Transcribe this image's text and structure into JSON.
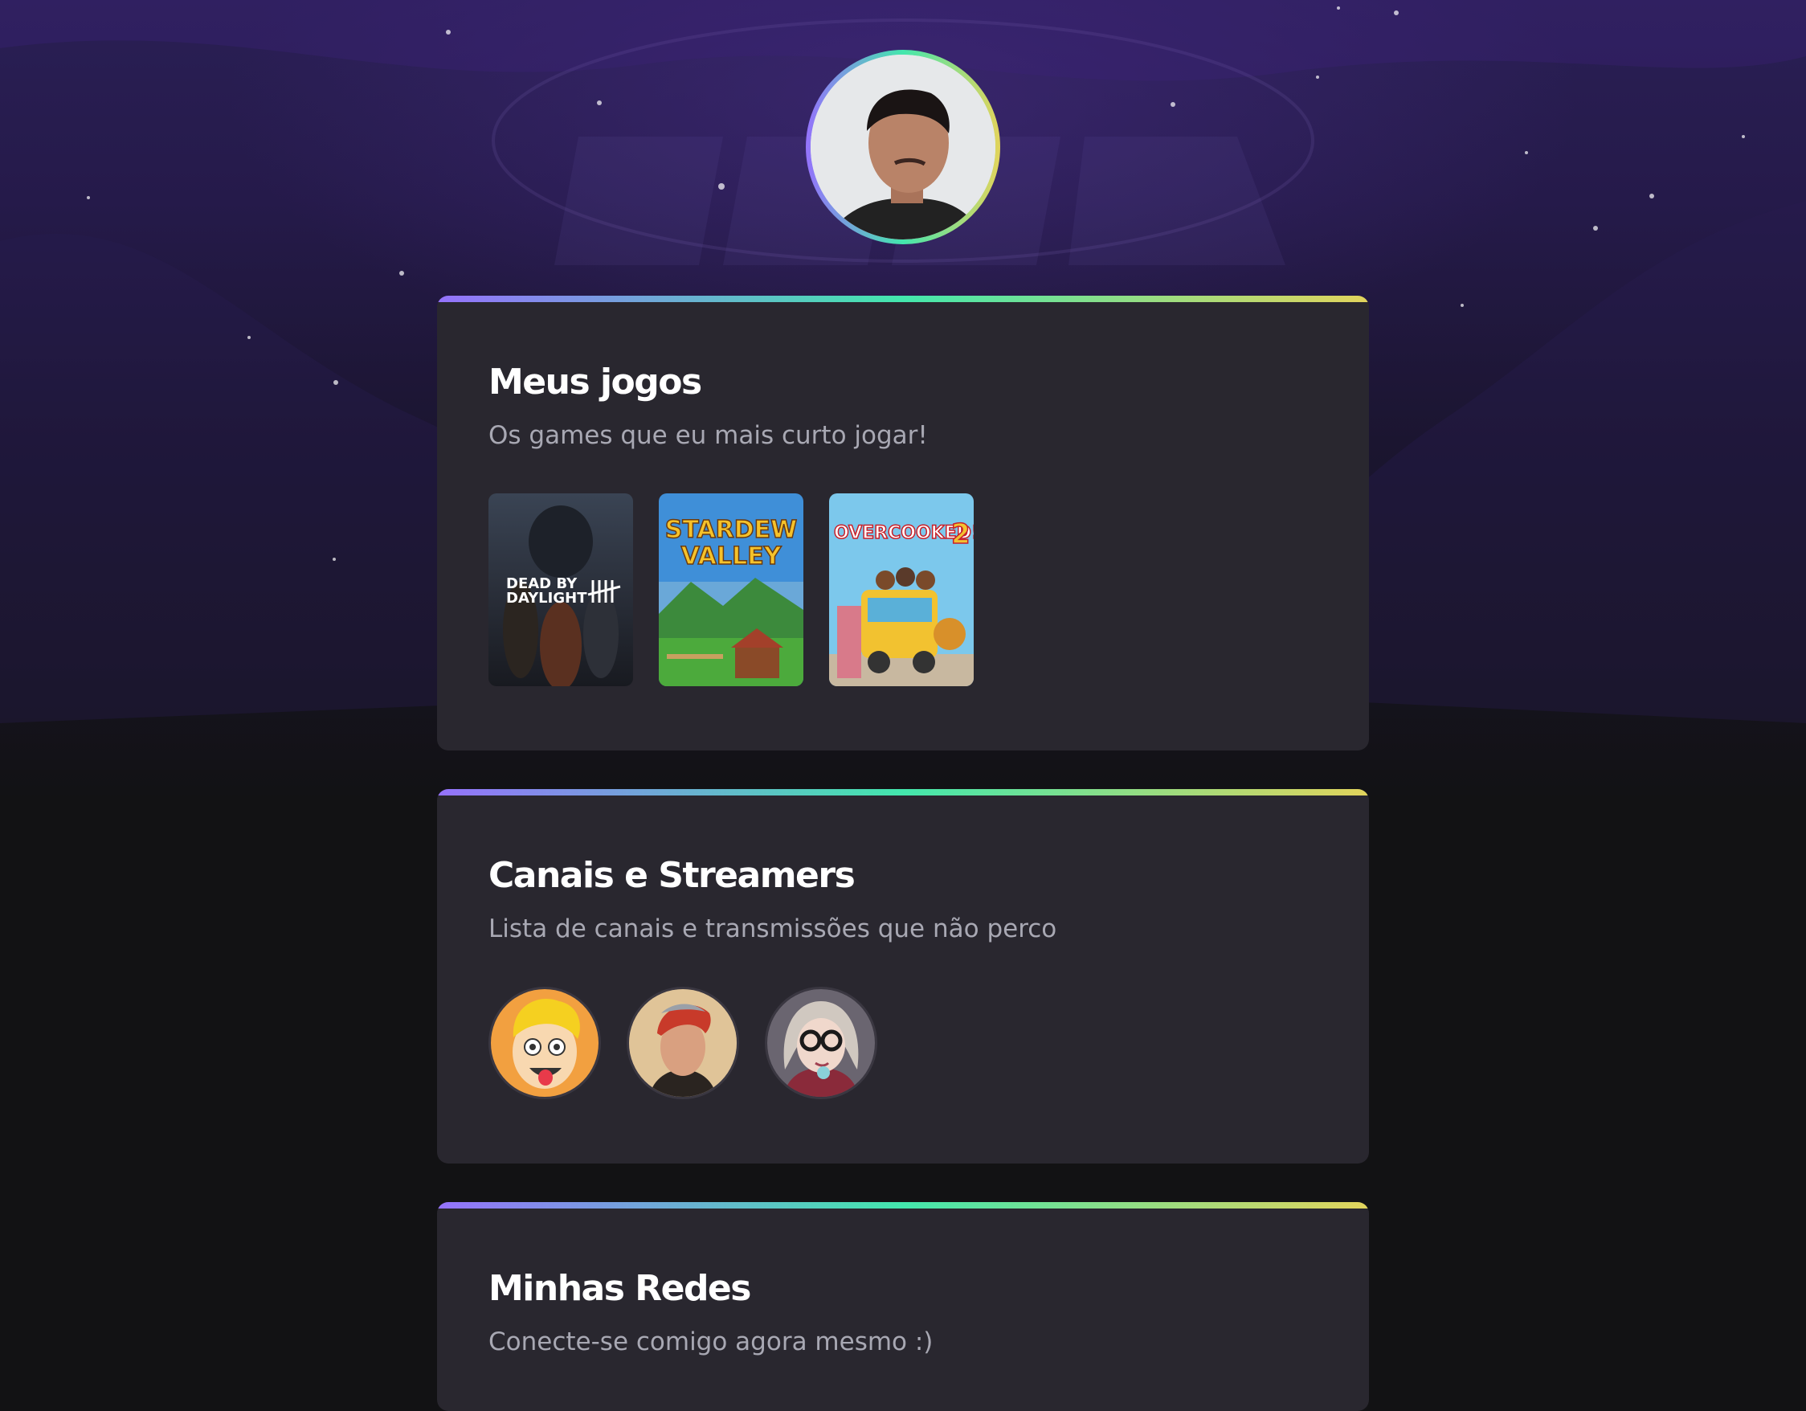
{
  "colors": {
    "gradient_start": "#9572FC",
    "gradient_mid": "#43E7AD",
    "gradient_end": "#E2D45C",
    "page_background": "#121214",
    "card_background": "#29272f",
    "heading": "#ffffff",
    "subtitle": "#a8a8b3"
  },
  "profile": {
    "avatar": "profile-photo"
  },
  "games_section": {
    "title": "Meus jogos",
    "subtitle": "Os games que eu mais curto jogar!",
    "games": [
      {
        "cover_text_line1": "DEAD BY",
        "cover_text_line2": "DAYLIGHT"
      },
      {
        "cover_text_line1": "STARDEW",
        "cover_text_line2": "VALLEY"
      },
      {
        "cover_text_line1": "OVERCOOKED!",
        "cover_text_line2": "2"
      }
    ]
  },
  "streamers_section": {
    "title": "Canais e Streamers",
    "subtitle": "Lista de canais e transmissões que não perco",
    "streamers": [
      {
        "icon": "cartoon-boy-avatar"
      },
      {
        "icon": "redhair-man-avatar"
      },
      {
        "icon": "glasses-girl-avatar"
      }
    ]
  },
  "social_section": {
    "title": "Minhas Redes",
    "subtitle": "Conecte-se comigo agora mesmo :)"
  }
}
